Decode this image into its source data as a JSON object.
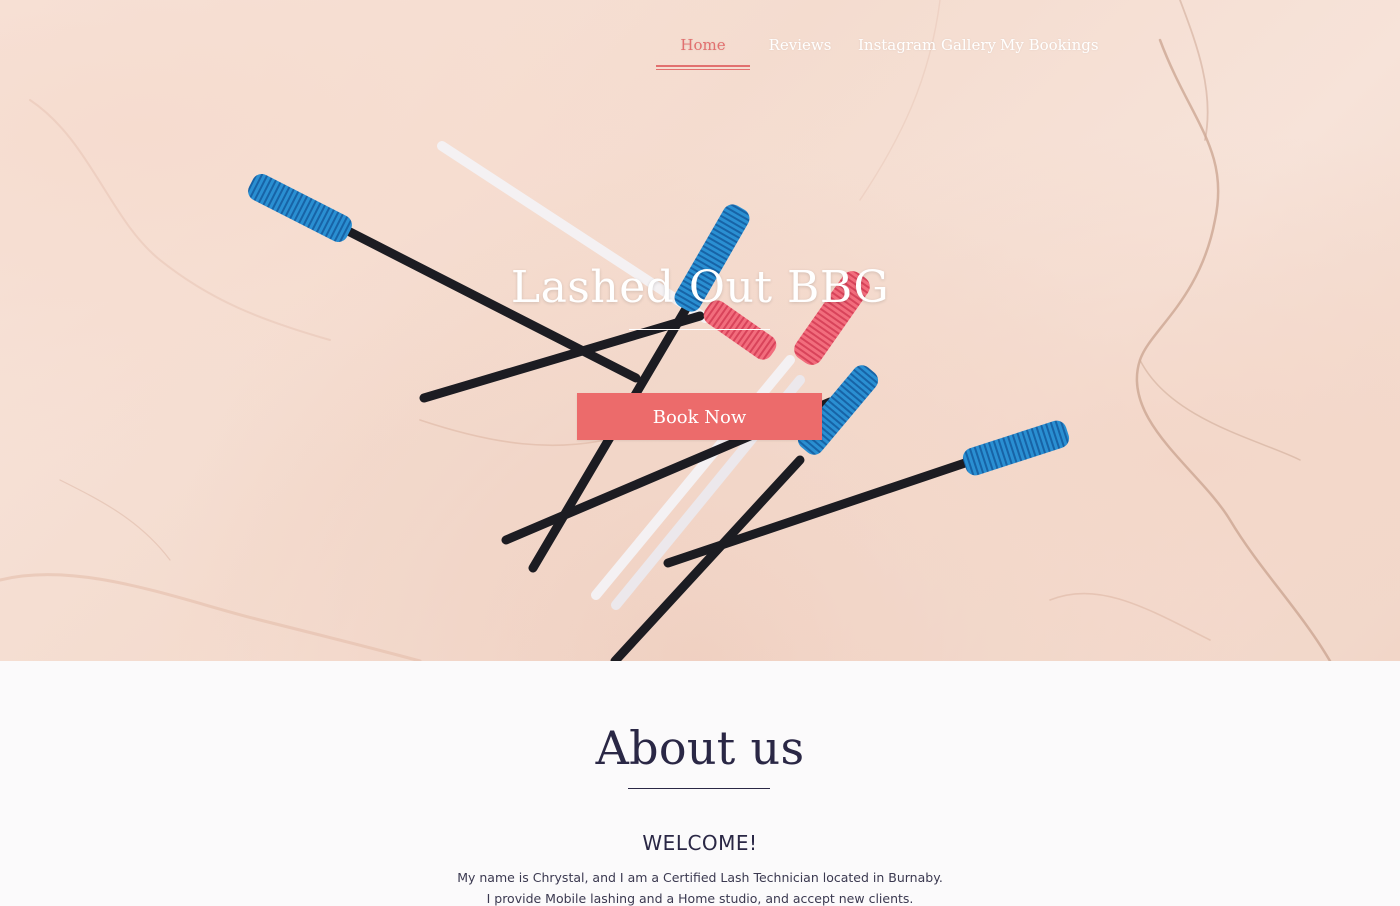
{
  "nav": {
    "items": [
      {
        "label": "Home",
        "active": true
      },
      {
        "label": "Reviews",
        "active": false
      },
      {
        "label": "Instagram Gallery",
        "active": false
      },
      {
        "label": "My Bookings",
        "active": false
      }
    ]
  },
  "hero": {
    "title": "Lashed Out BBG",
    "book_button": "Book Now",
    "background_image": "lash-wands-on-marble"
  },
  "about": {
    "title": "About us",
    "welcome": "WELCOME!",
    "line1": "My name is Chrystal, and I am a Certified Lash Technician located in Burnaby.",
    "line2": "I provide Mobile lashing and a Home studio, and accept new clients."
  },
  "colors": {
    "accent": "#ec6b6b",
    "nav_active": "#e2706f",
    "heading": "#2a2745",
    "brush_blue": "#1f7fc4",
    "brush_pink": "#ee5a6c",
    "wand_black": "#1c1c22",
    "wand_white": "#f4f1f3"
  }
}
